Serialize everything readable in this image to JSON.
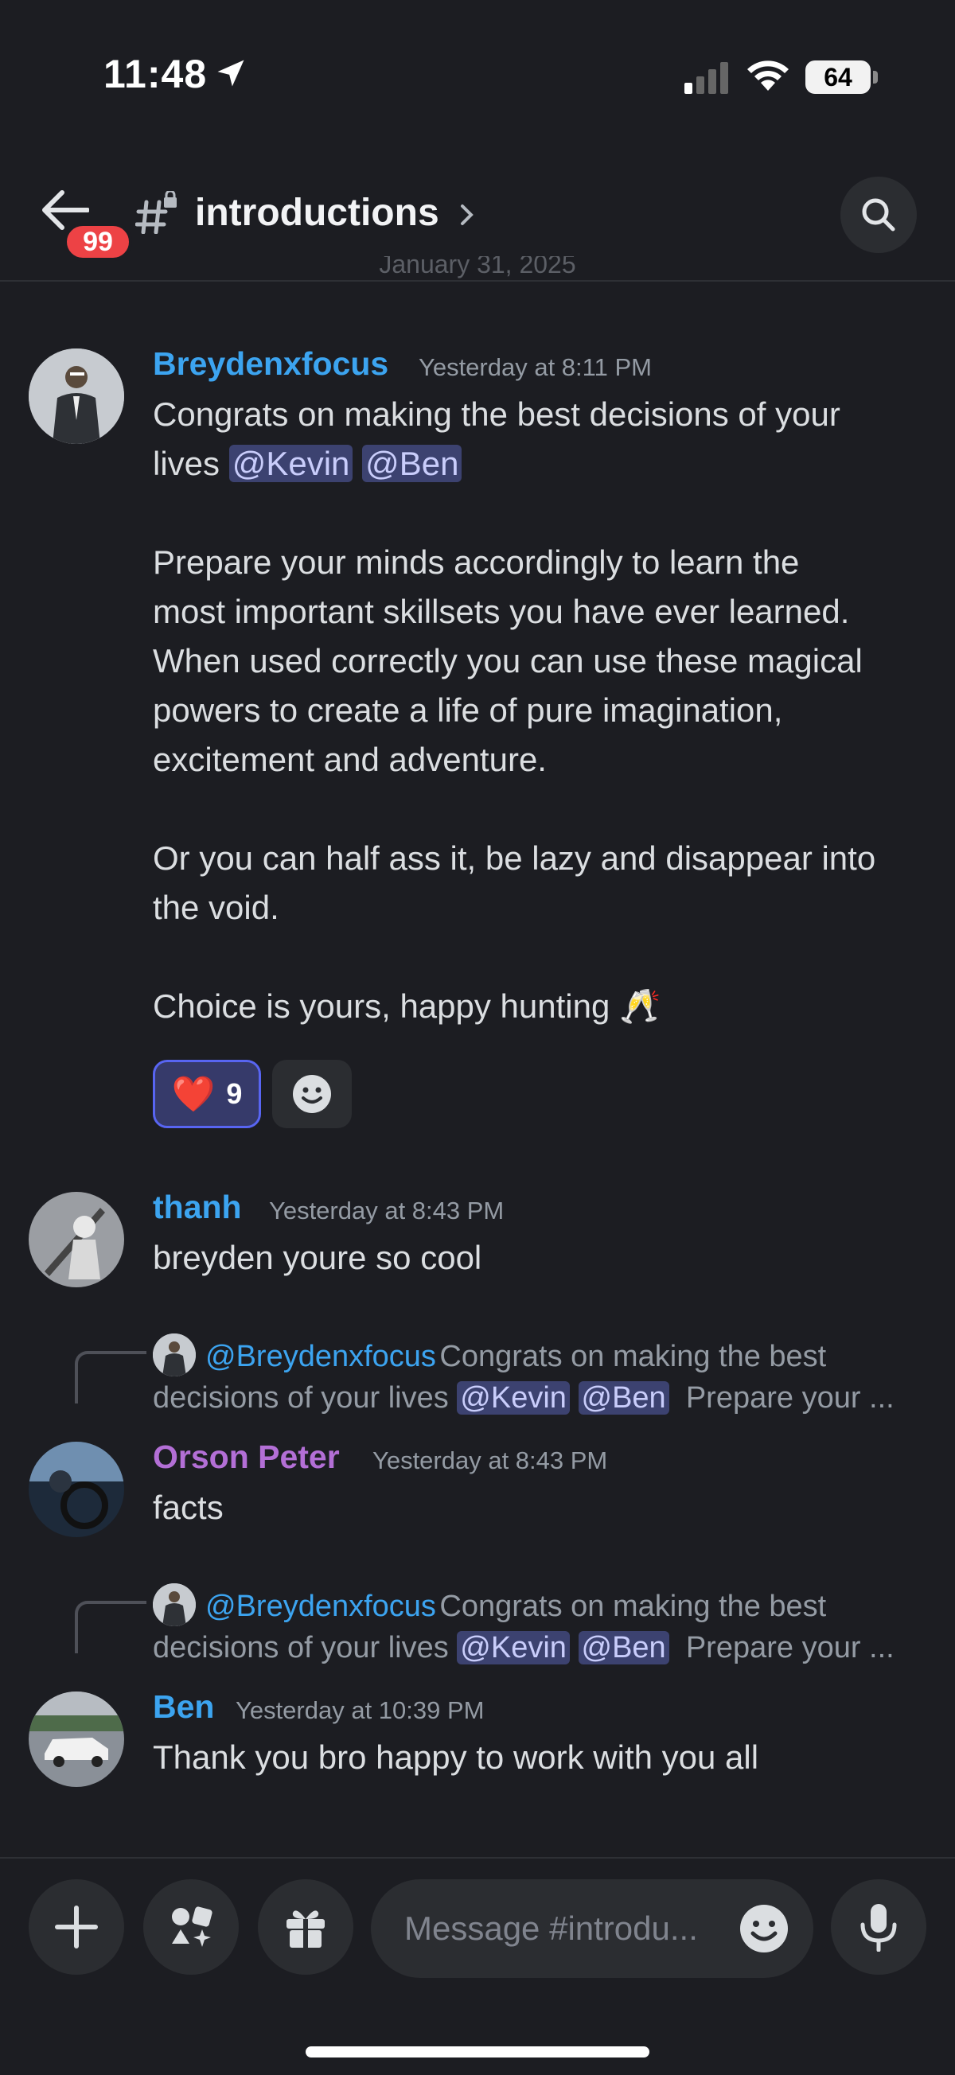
{
  "status_bar": {
    "time": "11:48",
    "battery": "64"
  },
  "header": {
    "unread_badge": "99",
    "channel_name": "introductions",
    "date_divider": "January 31, 2025"
  },
  "messages": [
    {
      "author": "Breydenxfocus",
      "author_color": "#3ca4f0",
      "timestamp": "Yesterday at 8:11 PM",
      "line1": "Congrats on making the best decisions of your",
      "line2_prefix": "lives ",
      "mention1": "@Kevin",
      "mention2": "@Ben",
      "para2": [
        "Prepare your minds accordingly to learn the",
        "most important skillsets you have ever learned.",
        "When used correctly you can use these magical",
        "powers to create a life of pure imagination,",
        "excitement and adventure."
      ],
      "para3": [
        "Or you can half ass it, be lazy and disappear into",
        "the void."
      ],
      "para4": "Choice is yours, happy hunting 🥂",
      "reaction": {
        "emoji": "❤️",
        "count": "9"
      }
    },
    {
      "author": "thanh",
      "author_color": "#3ca4f0",
      "timestamp": "Yesterday at 8:43 PM",
      "text": "breyden youre so cool"
    },
    {
      "reply": {
        "author": "@Breydenxfocus",
        "preview_line1": "Congrats on making the best",
        "preview_line2_prefix": "decisions of your lives ",
        "mention1": "@Kevin",
        "mention2": "@Ben",
        "preview_suffix": "Prepare your ..."
      },
      "author": "Orson Peter",
      "author_color": "#b36fd6",
      "timestamp": "Yesterday at 8:43 PM",
      "text": "facts"
    },
    {
      "reply": {
        "author": "@Breydenxfocus",
        "preview_line1": "Congrats on making the best",
        "preview_line2_prefix": "decisions of your lives ",
        "mention1": "@Kevin",
        "mention2": "@Ben",
        "preview_suffix": "Prepare your ..."
      },
      "author": "Ben",
      "author_color": "#3ca4f0",
      "timestamp": "Yesterday at 10:39 PM",
      "text": "Thank you bro happy to work with you all"
    }
  ],
  "composer": {
    "placeholder": "Message #introdu..."
  }
}
